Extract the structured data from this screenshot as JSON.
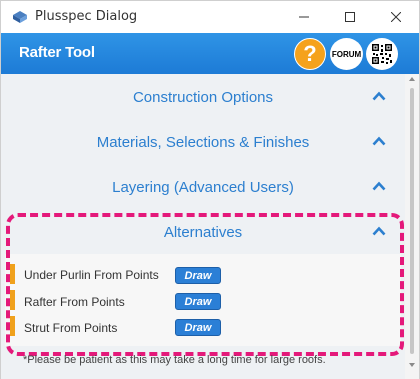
{
  "window": {
    "title": "Plusspec Dialog"
  },
  "header": {
    "title": "Rafter Tool",
    "help_label": "?",
    "forum_label": "FORUM"
  },
  "sections": [
    {
      "label": "Construction Options"
    },
    {
      "label": "Materials, Selections & Finishes"
    },
    {
      "label": "Layering (Advanced Users)"
    },
    {
      "label": "Alternatives"
    }
  ],
  "alternatives": {
    "items": [
      {
        "label": "Under Purlin From Points",
        "button": "Draw"
      },
      {
        "label": "Rafter From Points",
        "button": "Draw"
      },
      {
        "label": "Strut From Points",
        "button": "Draw"
      }
    ]
  },
  "footer": {
    "note": "*Please be patient as this may take a long time for large roofs."
  },
  "colors": {
    "accent": "#2c7fcf",
    "header": "#1d7bd6",
    "help": "#f5a21c",
    "highlight": "#e4197a",
    "row_marker": "#f0a11c"
  }
}
